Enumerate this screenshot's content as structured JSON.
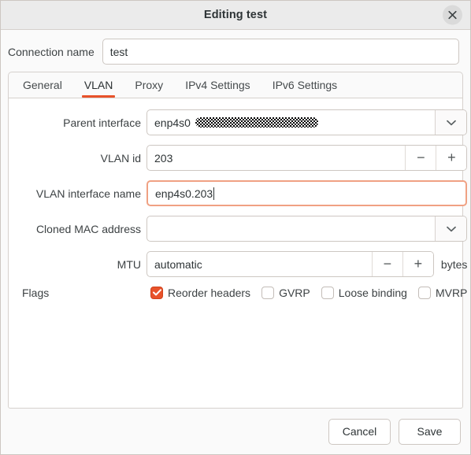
{
  "window": {
    "title": "Editing test",
    "close_icon": "close-icon"
  },
  "connection": {
    "label": "Connection name",
    "value": "test",
    "placeholder": ""
  },
  "tabs": [
    {
      "label": "General",
      "active": false
    },
    {
      "label": "VLAN",
      "active": true
    },
    {
      "label": "Proxy",
      "active": false
    },
    {
      "label": "IPv4 Settings",
      "active": false
    },
    {
      "label": "IPv6 Settings",
      "active": false
    }
  ],
  "vlan": {
    "parent_interface": {
      "label": "Parent interface",
      "value": "enp4s0",
      "redacted": true,
      "dropdown_icon": "chevron-down-icon"
    },
    "vlan_id": {
      "label": "VLAN id",
      "value": "203",
      "minus_label": "−",
      "plus_label": "+"
    },
    "vlan_interface_name": {
      "label": "VLAN interface name",
      "value": "enp4s0.203",
      "focused": true
    },
    "cloned_mac": {
      "label": "Cloned MAC address",
      "value": "",
      "dropdown_icon": "chevron-down-icon"
    },
    "mtu": {
      "label": "MTU",
      "value": "automatic",
      "units": "bytes",
      "minus_label": "−",
      "plus_label": "+"
    },
    "flags": {
      "label": "Flags",
      "items": [
        {
          "label": "Reorder headers",
          "checked": true
        },
        {
          "label": "GVRP",
          "checked": false
        },
        {
          "label": "Loose binding",
          "checked": false
        },
        {
          "label": "MVRP",
          "checked": false
        }
      ]
    }
  },
  "actions": {
    "cancel_label": "Cancel",
    "save_label": "Save"
  },
  "colors": {
    "accent": "#e8522a",
    "focus_border": "#f0a183",
    "titlebar_bg": "#ebebeb",
    "window_bg": "#fafafa",
    "border": "#cdc7c2"
  }
}
